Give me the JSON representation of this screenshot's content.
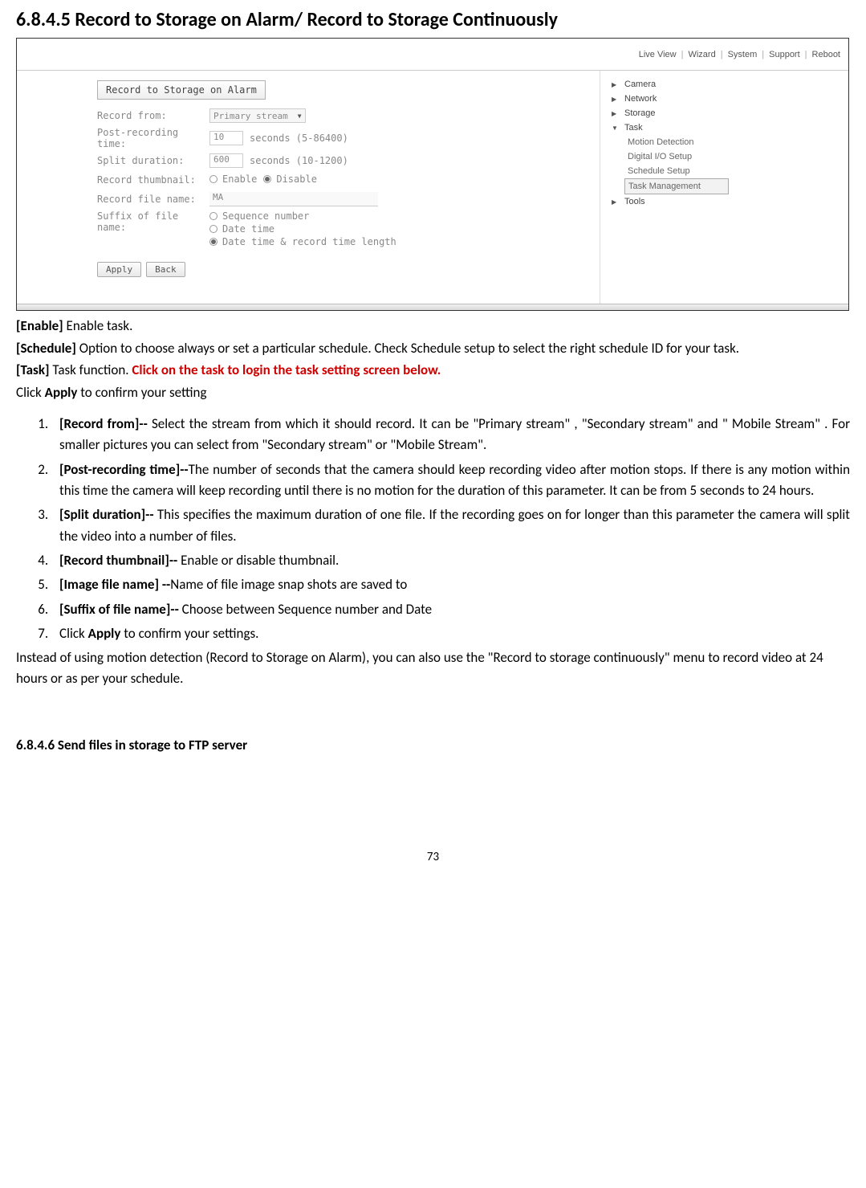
{
  "section": {
    "title": "6.8.4.5 Record to Storage on Alarm/ Record to Storage Continuously"
  },
  "screenshot": {
    "topnav": {
      "live_view": "Live View",
      "wizard": "Wizard",
      "system": "System",
      "support": "Support",
      "reboot": "Reboot"
    },
    "panel_title": "Record to Storage on Alarm",
    "fields": {
      "record_from_label": "Record from:",
      "record_from_select": "Primary stream",
      "post_recording_label": "Post-recording time:",
      "post_recording_value": "10",
      "post_recording_suffix": "seconds (5-86400)",
      "split_duration_label": "Split duration:",
      "split_duration_value": "600",
      "split_duration_suffix": "seconds (10-1200)",
      "record_thumbnail_label": "Record thumbnail:",
      "enable": "Enable",
      "disable": "Disable",
      "record_filename_label": "Record file name:",
      "record_filename_value": "MA",
      "suffix_label": "Suffix of file name:",
      "suffix_opt1": "Sequence number",
      "suffix_opt2": "Date time",
      "suffix_opt3": "Date time & record time length"
    },
    "buttons": {
      "apply": "Apply",
      "back": "Back"
    },
    "sidebar": {
      "camera": "Camera",
      "network": "Network",
      "storage": "Storage",
      "task": "Task",
      "motion_detection": "Motion Detection",
      "digital_io": "Digital I/O Setup",
      "schedule_setup": "Schedule Setup",
      "task_management": "Task Management",
      "tools": "Tools"
    }
  },
  "doc": {
    "enable_label": "[Enable] ",
    "enable_text": "Enable task.",
    "schedule_label": "[Schedule] ",
    "schedule_text": "Option to choose always or set a particular schedule. Check Schedule setup to select the right schedule ID for your task.",
    "task_label": "[Task] ",
    "task_text1": "Task function. ",
    "task_red": "Click on the task to login the task setting screen below.",
    "apply_text1": "Click ",
    "apply_bold": "Apply",
    "apply_text2": " to confirm your setting",
    "li1_label": "[Record from]-- ",
    "li1_text": "Select the stream from which it should record. It can be \"Primary stream\" , \"Secondary stream\" and \" Mobile Stream\" . For smaller pictures you can select from \"Secondary stream\" or \"Mobile Stream\".",
    "li2_label": "[Post-recording time]--",
    "li2_text": "The number of seconds that the camera should keep recording video after motion stops. If there is any motion within this time the camera will keep recording until there is no motion for the duration of this parameter. It can be from 5 seconds to 24 hours.",
    "li3_label": "[Split duration]-- ",
    "li3_text": "This specifies the maximum duration of one file. If the recording goes on for longer than this parameter the camera will split the video into a number of files.",
    "li4_label": "[Record thumbnail]-- ",
    "li4_text": "Enable or disable thumbnail.",
    "li5_label": "[Image file name] --",
    "li5_text": "Name of file image snap shots are saved to",
    "li6_label": "[Suffix of file name]-- ",
    "li6_text": "Choose between Sequence number and Date",
    "li7_text1": "Click ",
    "li7_bold": "Apply",
    "li7_text2": " to confirm your settings.",
    "trailing": "Instead of using motion detection (Record to Storage on Alarm), you can also use the \"Record to storage continuously\" menu to record video at 24 hours or as per your schedule."
  },
  "subsection_title": "6.8.4.6 Send files in storage to FTP server",
  "page_number": "73"
}
